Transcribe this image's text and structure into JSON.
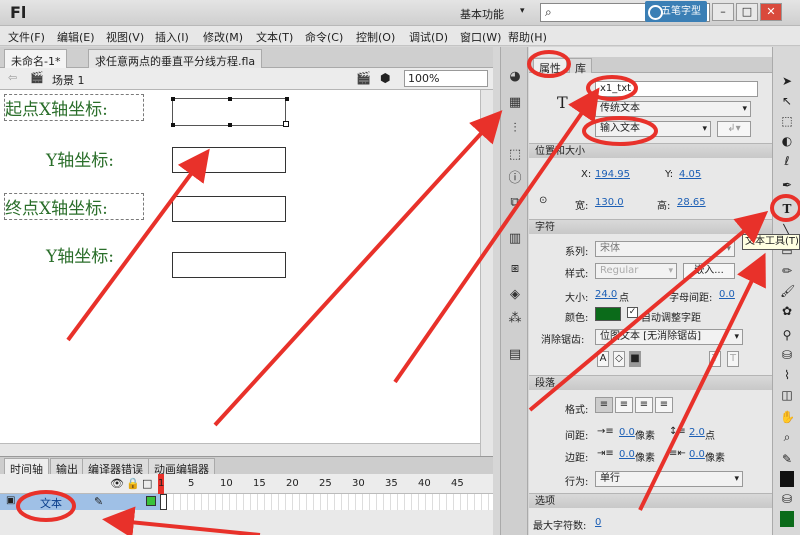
{
  "app": {
    "logo": "Fl",
    "workspace": "基本功能",
    "watermark": "五笔字型"
  },
  "menu": [
    "文件(F)",
    "编辑(E)",
    "视图(V)",
    "插入(I)",
    "修改(M)",
    "文本(T)",
    "命令(C)",
    "控制(O)",
    "调试(D)",
    "窗口(W)",
    "帮助(H)"
  ],
  "doc_tabs": [
    "未命名-1*",
    "求任意两点的垂直平分线方程.fla"
  ],
  "scene": {
    "name": "场景 1",
    "zoom": "100%"
  },
  "stage": {
    "labels": [
      "起点X轴坐标:",
      "Y轴坐标:",
      "终点X轴坐标:",
      "Y轴坐标:"
    ]
  },
  "timeline": {
    "tabs": [
      "时间轴",
      "输出",
      "编译器错误",
      "动画编辑器"
    ],
    "frame_numbers": [
      "1",
      "5",
      "10",
      "15",
      "20",
      "25",
      "30",
      "35",
      "40",
      "45"
    ],
    "layer_name": "文本"
  },
  "props": {
    "tabs": [
      "属性",
      "库"
    ],
    "instance_name": "x1_txt",
    "text_engine": "传统文本",
    "text_type": "输入文本",
    "sec_position": "位置和大小",
    "x_label": "X:",
    "x_value": "194.95",
    "y_label": "Y:",
    "y_value": "4.05",
    "w_label": "宽:",
    "w_value": "130.0",
    "h_label": "高:",
    "h_value": "28.65",
    "sec_char": "字符",
    "family_label": "系列:",
    "family_value": "宋体",
    "style_label": "样式:",
    "style_value": "Regular",
    "embed_label": "嵌入...",
    "size_label": "大小:",
    "size_value": "24.0",
    "size_unit": "点",
    "spacing_label": "字母间距:",
    "spacing_value": "0.0",
    "color_label": "颜色:",
    "color_hex": "#0b6b1a",
    "autokern_label": "自动调整字距",
    "aa_label": "消除锯齿:",
    "aa_value": "位图文本 [无消除锯齿]",
    "sec_para": "段落",
    "format_label": "格式:",
    "gap_label": "间距:",
    "gap_value": "0.0",
    "gap_unit": "像素",
    "line_value": "2.0",
    "line_unit": "点",
    "margin_label": "边距:",
    "margin_left": "0.0",
    "margin_left_unit": "像素",
    "margin_right": "0.0",
    "margin_right_unit": "像素",
    "behavior_label": "行为:",
    "behavior_value": "单行",
    "sec_options": "选项",
    "maxchars_label": "最大字符数:",
    "maxchars_value": "0"
  },
  "tooltip": "文本工具(T)",
  "icons": [
    "swatches-icon",
    "grid-icon",
    "align-icon",
    "transform-icon",
    "info-icon",
    "scene-icon",
    "library-icon",
    "component-icon",
    "motion-presets-icon",
    "bone-icon",
    "movie-explorer-icon"
  ],
  "tools": [
    "selection-icon",
    "subselection-icon",
    "free-transform-icon",
    "3d-rotate-icon",
    "lasso-icon",
    "pen-icon",
    "text-tool-icon",
    "line-icon",
    "rectangle-icon",
    "pencil-icon",
    "brush-icon",
    "deco-icon",
    "bone-tool-icon",
    "paint-bucket-icon",
    "eyedropper-icon",
    "eraser-icon",
    "hand-icon",
    "zoom-icon",
    "stroke-color-icon",
    "fill-color-icon"
  ],
  "colors": {
    "accent_red": "#e8312a",
    "green_label": "#2a6e2a",
    "highlight": "#9fc0e6"
  }
}
